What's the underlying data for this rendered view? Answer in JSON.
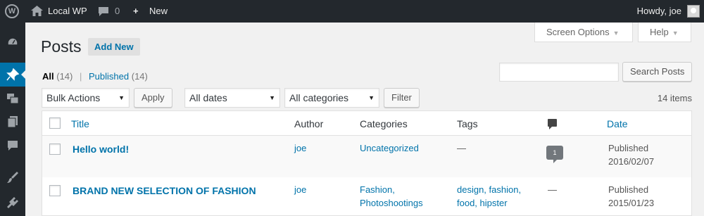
{
  "adminbar": {
    "site_name": "Local WP",
    "comments_count": "0",
    "new_label": "New",
    "howdy": "Howdy, joe"
  },
  "screen_meta": {
    "screen_options": "Screen Options",
    "help": "Help"
  },
  "page": {
    "title": "Posts",
    "add_new": "Add New"
  },
  "views": {
    "all_label": "All",
    "all_count": "(14)",
    "separator": "|",
    "published_label": "Published",
    "published_count": "(14)"
  },
  "search": {
    "value": "",
    "button": "Search Posts"
  },
  "filters": {
    "bulk_actions": "Bulk Actions",
    "apply": "Apply",
    "dates": "All dates",
    "categories": "All categories",
    "filter": "Filter",
    "items_count": "14 items"
  },
  "table": {
    "columns": {
      "title": "Title",
      "author": "Author",
      "categories": "Categories",
      "tags": "Tags",
      "date": "Date"
    },
    "rows": [
      {
        "title": "Hello world!",
        "author": "joe",
        "categories": [
          "Uncategorized"
        ],
        "tags": [],
        "tags_empty": "—",
        "comments": "1",
        "date_status": "Published",
        "date": "2016/02/07"
      },
      {
        "title": "BRAND NEW SELECTION OF FASHION",
        "author": "joe",
        "categories": [
          "Fashion,",
          "Photoshootings"
        ],
        "tags": [
          "design, fashion,",
          "food, hipster"
        ],
        "comments_empty": "—",
        "date_status": "Published",
        "date": "2015/01/23"
      }
    ]
  },
  "colors": {
    "adminbar_bg": "#23282d",
    "link": "#0073aa",
    "page_bg": "#f1f1f1",
    "current_menu": "#0073aa"
  },
  "icons": [
    "wordpress-logo-icon",
    "home-icon",
    "comment-icon",
    "plus-icon",
    "avatar",
    "dashboard-icon",
    "pin-icon",
    "media-icon",
    "pages-icon",
    "comments-menu-icon",
    "appearance-icon",
    "plugins-icon"
  ]
}
